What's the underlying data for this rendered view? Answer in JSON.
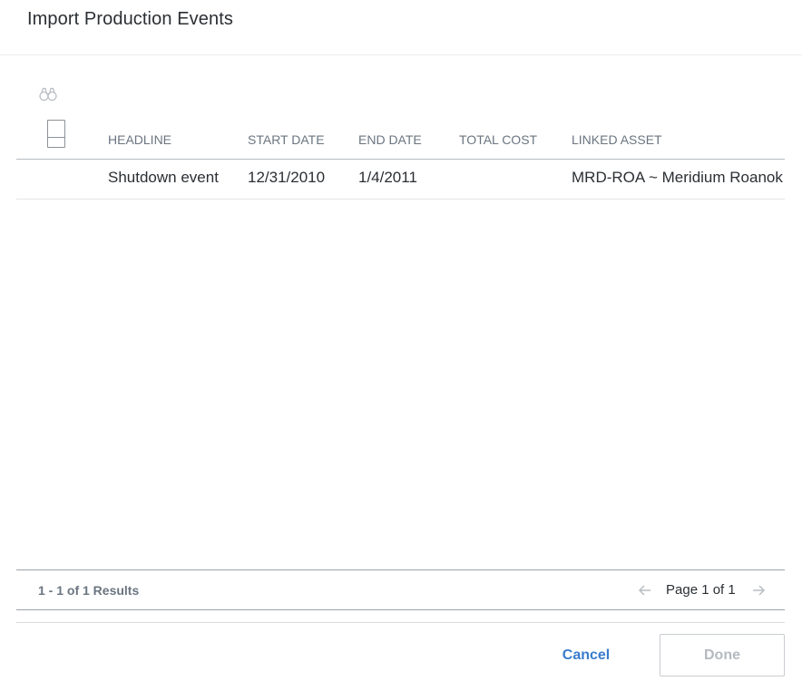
{
  "dialog": {
    "title": "Import Production Events"
  },
  "toolbar": {
    "search_icon": "binoculars-icon"
  },
  "grid": {
    "columns": [
      "HEADLINE",
      "START DATE",
      "END DATE",
      "TOTAL COST",
      "LINKED ASSET"
    ],
    "rows": [
      {
        "headline": "Shutdown event",
        "start_date": "12/31/2010",
        "end_date": "1/4/2011",
        "total_cost": "",
        "linked_asset": "MRD-ROA ~ Meridium Roanok"
      }
    ]
  },
  "pager": {
    "results": "1 - 1 of 1 Results",
    "page_label": "Page 1 of 1",
    "prev_icon": "arrow-left-icon",
    "next_icon": "arrow-right-icon"
  },
  "footer": {
    "cancel_label": "Cancel",
    "done_label": "Done"
  },
  "colors": {
    "accent": "#3a7ccc",
    "header_text": "#6b7580",
    "disabled_text": "#b4bac0"
  }
}
